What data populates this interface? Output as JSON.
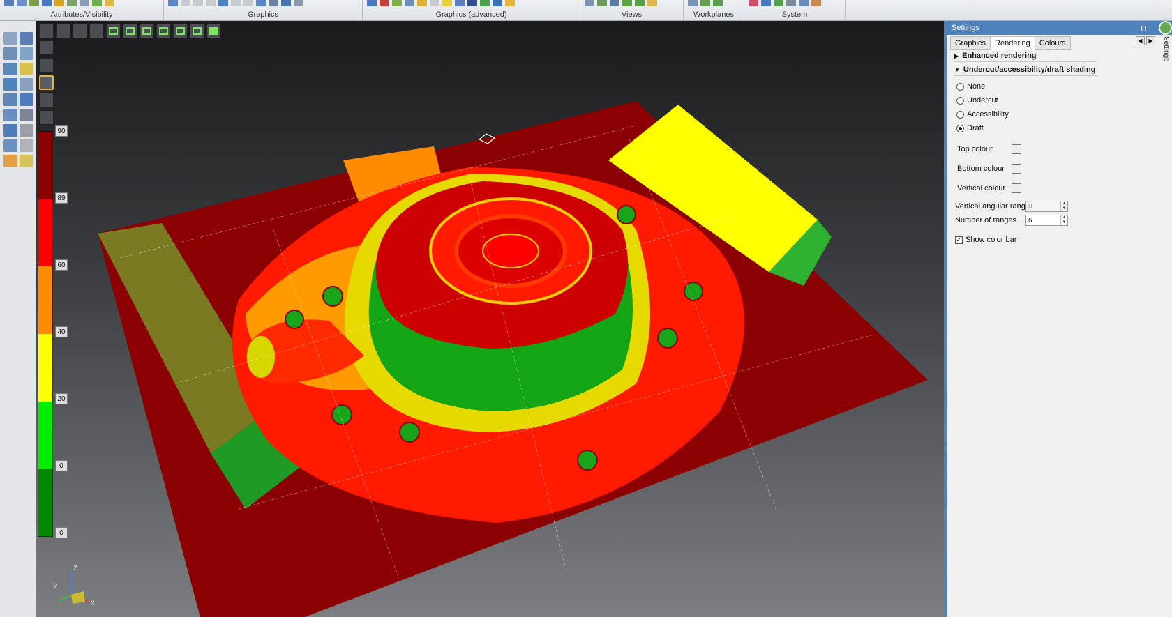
{
  "ribbon": {
    "groups": [
      {
        "label": "Attributes/Visibility"
      },
      {
        "label": "Graphics"
      },
      {
        "label": "Graphics (advanced)"
      },
      {
        "label": "Views"
      },
      {
        "label": "Workplanes"
      },
      {
        "label": "System"
      }
    ]
  },
  "colorbar": {
    "ticks": [
      "90",
      "89",
      "60",
      "40",
      "20",
      "0",
      "0"
    ],
    "colors": [
      "#8b0000",
      "#ff0000",
      "#ff8c00",
      "#ffff00",
      "#00ee00",
      "#008800"
    ]
  },
  "triad": {
    "x": "X",
    "y": "Y",
    "z": "Z"
  },
  "panel": {
    "title": "Settings",
    "pin_glyph": "⊓ ✕",
    "side_tab": "Settings",
    "tabs": [
      "Graphics",
      "Rendering",
      "Colours"
    ],
    "active_tab": "Rendering",
    "sections": {
      "enhanced": "Enhanced rendering",
      "undercut": "Undercut/accessibility/draft shading"
    },
    "radios": [
      {
        "label": "None",
        "checked": false
      },
      {
        "label": "Undercut",
        "checked": false
      },
      {
        "label": "Accessibility",
        "checked": false
      },
      {
        "label": "Draft",
        "checked": true
      }
    ],
    "colors": {
      "top": "Top colour",
      "bottom": "Bottom colour",
      "vertical": "Vertical colour"
    },
    "vertical_angular_range": {
      "label": "Vertical angular range",
      "value": "0"
    },
    "number_of_ranges": {
      "label": "Number of ranges",
      "value": "6"
    },
    "show_color_bar": {
      "label": "Show color bar",
      "checked": true
    }
  }
}
